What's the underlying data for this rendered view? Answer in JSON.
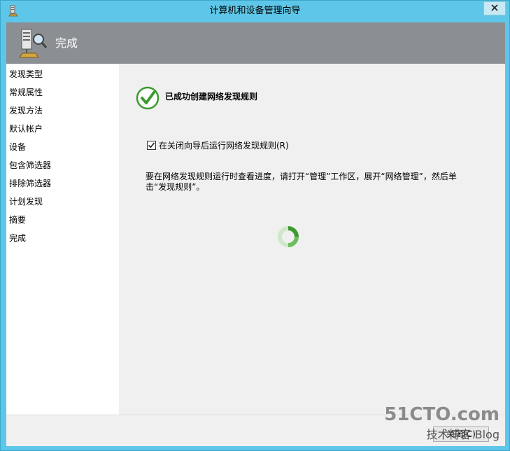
{
  "window": {
    "title": "计算机和设备管理向导"
  },
  "header": {
    "title": "完成"
  },
  "sidebar": {
    "items": [
      {
        "label": "发现类型"
      },
      {
        "label": "常规属性"
      },
      {
        "label": "发现方法"
      },
      {
        "label": "默认帐户"
      },
      {
        "label": "设备"
      },
      {
        "label": "包含筛选器"
      },
      {
        "label": "排除筛选器"
      },
      {
        "label": "计划发现"
      },
      {
        "label": "摘要"
      },
      {
        "label": "完成"
      }
    ]
  },
  "content": {
    "success_message": "已成功创建网络发现规则",
    "checkbox_label": "在关闭向导后运行网络发现规则(R)",
    "checkbox_checked": true,
    "info_text": "要在网络发现规则运行时查看进度，请打开“管理”工作区，展开“网络管理”，然后单击“发现规则”。"
  },
  "footer": {
    "button_label": "关闭(C)"
  },
  "watermark": {
    "main": "51CTO.com",
    "sub": "技术博客 Blog"
  },
  "colors": {
    "title_bar": "#5ec6e8",
    "header_bg": "#8b8e93",
    "success_green": "#3a9a2e"
  }
}
